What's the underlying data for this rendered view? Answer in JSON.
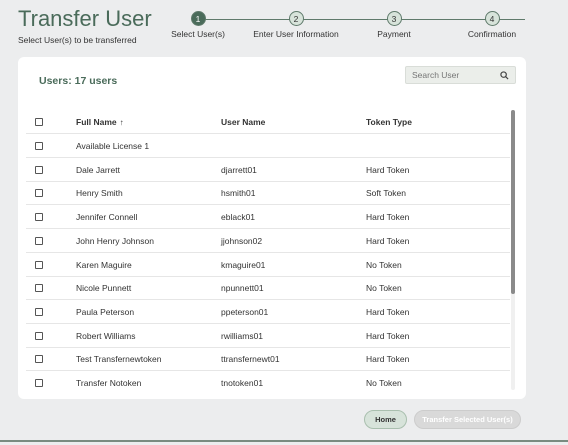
{
  "page": {
    "title": "Transfer User",
    "subtitle": "Select User(s) to be transferred"
  },
  "stepper": {
    "steps": [
      {
        "number": "1",
        "label": "Select User(s)",
        "state": "active"
      },
      {
        "number": "2",
        "label": "Enter User Information",
        "state": "pending"
      },
      {
        "number": "3",
        "label": "Payment",
        "state": "pending"
      },
      {
        "number": "4",
        "label": "Confirmation",
        "state": "pending"
      }
    ]
  },
  "users_panel": {
    "count_label": "Users: 17 users",
    "search_placeholder": "Search User",
    "columns": {
      "full_name": "Full Name",
      "user_name": "User Name",
      "token_type": "Token Type"
    },
    "rows": [
      {
        "full_name": "Available License 1",
        "user_name": "",
        "token_type": ""
      },
      {
        "full_name": "Dale Jarrett",
        "user_name": "djarrett01",
        "token_type": "Hard Token"
      },
      {
        "full_name": "Henry Smith",
        "user_name": "hsmith01",
        "token_type": "Soft Token"
      },
      {
        "full_name": "Jennifer Connell",
        "user_name": "eblack01",
        "token_type": "Hard Token"
      },
      {
        "full_name": "John Henry Johnson",
        "user_name": "jjohnson02",
        "token_type": "Hard Token"
      },
      {
        "full_name": "Karen Maguire",
        "user_name": "kmaguire01",
        "token_type": "No Token"
      },
      {
        "full_name": "Nicole Punnett",
        "user_name": "npunnett01",
        "token_type": "No Token"
      },
      {
        "full_name": "Paula Peterson",
        "user_name": "ppeterson01",
        "token_type": "Hard Token"
      },
      {
        "full_name": "Robert Williams",
        "user_name": "rwilliams01",
        "token_type": "Hard Token"
      },
      {
        "full_name": "Test Transfernewtoken",
        "user_name": "ttransfernewt01",
        "token_type": "Hard Token"
      },
      {
        "full_name": "Transfer Notoken",
        "user_name": "tnotoken01",
        "token_type": "No Token"
      }
    ]
  },
  "actions": {
    "home_label": "Home",
    "transfer_label": "Transfer Selected User(s)"
  },
  "colors": {
    "brand": "#4a6b5a",
    "step_pending": "#d7e3da",
    "background": "#ecedee"
  }
}
